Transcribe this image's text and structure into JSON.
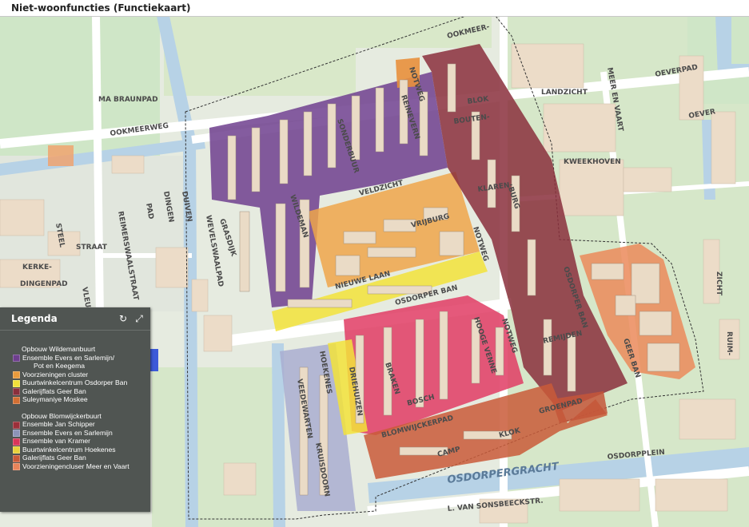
{
  "title": "Niet-woonfuncties (Functiekaart)",
  "legend": {
    "title": "Legenda",
    "refresh_icon": "refresh-icon",
    "collapse_icon": "collapse-icon",
    "group1_heading": "Opbouw Wildemanbuurt",
    "group1_items": [
      {
        "label": "Ensemble Evers en Sarlemijn/",
        "color": "#6e3f8e"
      },
      {
        "label": "Voorzieningen cluster",
        "color": "#e89a3c"
      },
      {
        "label": "Buurtwinkelcentrum Osdorper Ban",
        "color": "#f0e03a"
      },
      {
        "label": "Galerijflats Geer Ban",
        "color": "#8a2f3c"
      },
      {
        "label": "Suleymaniye Moskee",
        "color": "#d36f33"
      }
    ],
    "group1_sub": "Pot en Keegema",
    "group2_heading": "Opbouw Blomwijckerbuurt",
    "group2_items": [
      {
        "label": "Ensemble Jan Schipper",
        "color": "#9b2f3a"
      },
      {
        "label": "Ensemble Evers en Sarlemijn",
        "color": "#8c93b8"
      },
      {
        "label": "Ensemble van Kramer",
        "color": "#d9365a"
      },
      {
        "label": "Buurtwinkelcentrum Hoekenes",
        "color": "#e8d23a"
      },
      {
        "label": "Galerijflats Geer Ban",
        "color": "#c95a38"
      },
      {
        "label": "Voorzieningencluser Meer en Vaart",
        "color": "#e8845a"
      }
    ]
  },
  "map_labels": {
    "ookmeer": "OOKMEER-",
    "oostmeerweg": "OOKMEERWEG",
    "braunpad": "MA BRAUNPAD",
    "notweg1": "NOTWEG",
    "notweg2": "NOTWEG",
    "notweg3": "NOTWEG",
    "reinevern": "REINEVERN",
    "sonderbuur": "SONDERBUUR",
    "veldzicht": "VELDZICHT",
    "vrijburg": "VRIJBURG",
    "wildeman": "WILDEMAN",
    "osdorperban": "OSDORPER BAN",
    "osdorperban2": "OSDORPER BAN",
    "nieuwelaan": "NIEUWE LAAN",
    "boutenburg": "BOUTEN-",
    "klarenburg": "KLAREN-",
    "burg": "BURG",
    "landzicht": "LANDZICHT",
    "kweekhoven": "KWEEKHOVEN",
    "meerenvaart": "MEER EN VAART",
    "oeverpad": "OEVERPAD",
    "oever": "OEVER",
    "hoekenes": "HOEKENES",
    "hoogevenne": "HOOGE VENNE",
    "remijden": "REMIJDEN",
    "geerban": "GEER BAN",
    "blomwijckerpad": "BLOMWIJCKERPAD",
    "braken": "BRAKEN",
    "bosch": "BOSCH",
    "klok": "KLOK",
    "camp": "CAMP",
    "groenpad": "GROENPAD",
    "osdorpergracht": "OSDORPERGRACHT",
    "osdorpplein": "OSDORPPLEIN",
    "sonsbeeck": "L. VAN SONSBEECKSTR.",
    "reimerswaalstraat": "REIMERSWAALSTRAAT",
    "straat": "STRAAT",
    "kerke": "KERKE-",
    "dingenpad": "DINGENPAD",
    "zicht": "ZICHT",
    "ruim": "RUIM-",
    "drie": "DRIEHUIZEN",
    "kruis": "KRUISDOORN",
    "vleu": "VLEUTEN",
    "steel": "STEEL",
    "wervel": "WEVELSWAALPAD",
    "dingen": "DINGEN",
    "duiv": "DUIVEN",
    "pad": "PAD",
    "vesd": "VEEDEWARTEN",
    "blok": "BLOK",
    "grasdijk": "GRASDIJK"
  }
}
